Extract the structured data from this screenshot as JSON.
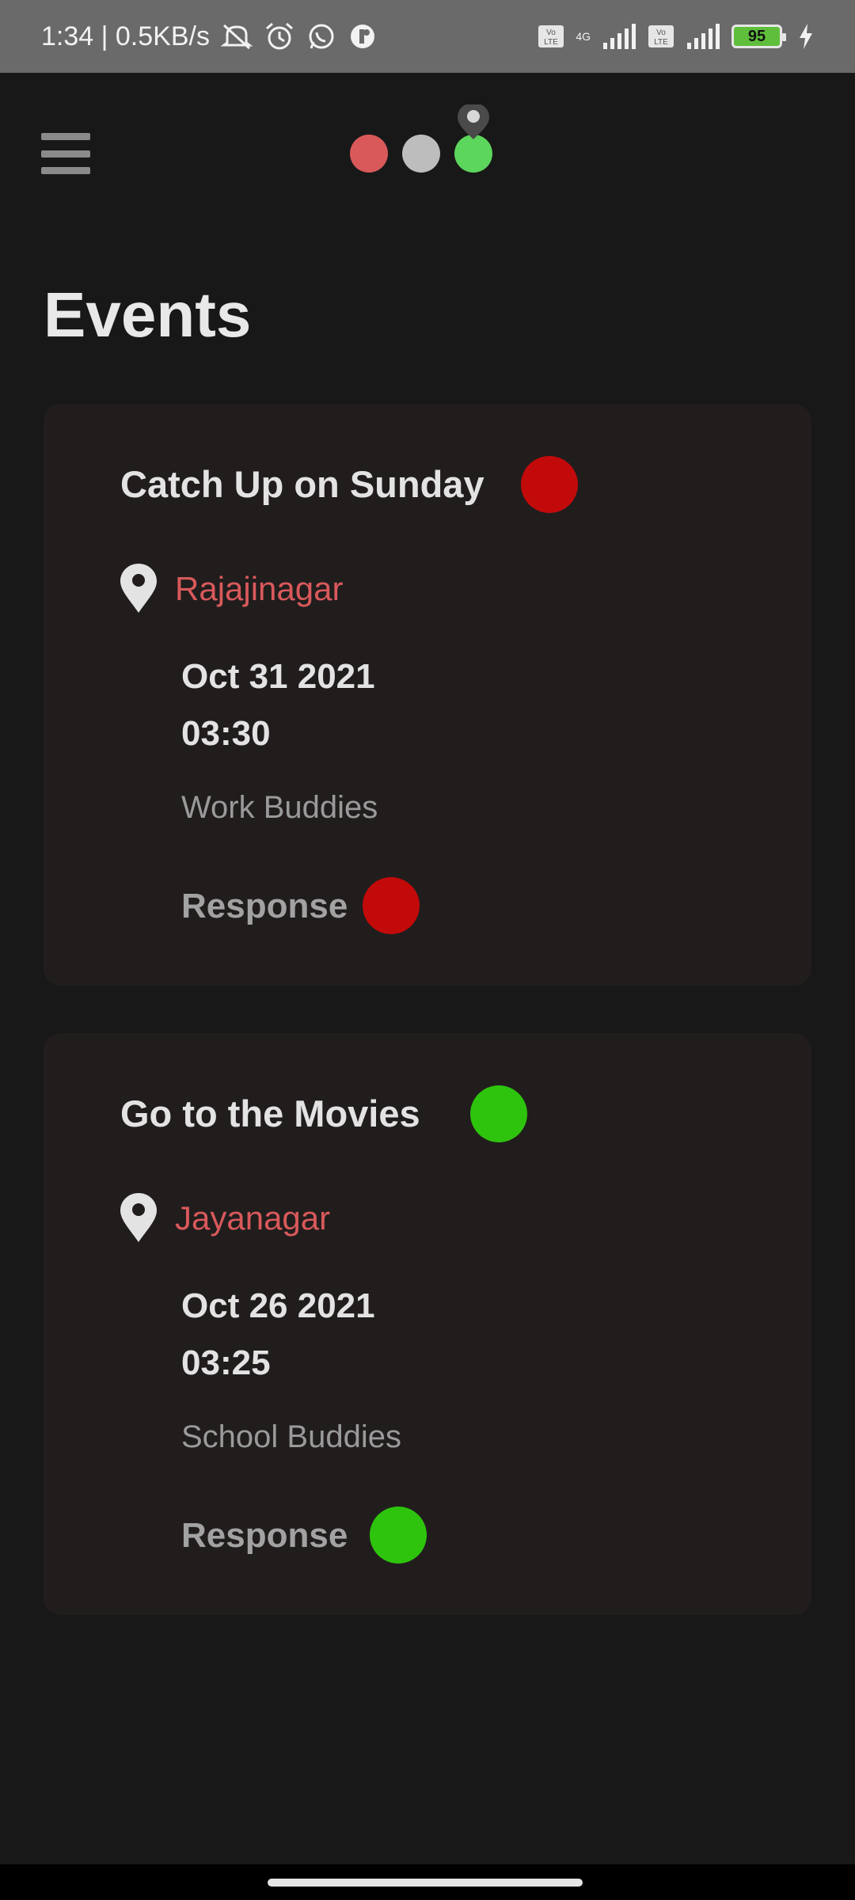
{
  "status_bar": {
    "time_speed": "1:34 | 0.5KB/s",
    "network_label": "4G",
    "volte_label": "Vo LTE",
    "battery_level": "95",
    "icons": [
      "mute-icon",
      "alarm-icon",
      "whatsapp-icon",
      "app-notification-icon",
      "volte-icon",
      "signal-icon",
      "battery-icon",
      "charging-icon"
    ]
  },
  "app_bar": {
    "menu_icon": "hamburger-menu-icon",
    "logo_colors": [
      "#d9595b",
      "#bdbdbd",
      "#5cd65c"
    ],
    "logo_pin_color": "#4a4a4a"
  },
  "page": {
    "title": "Events"
  },
  "events": [
    {
      "title": "Catch Up on Sunday",
      "status_color": "#c30a0a",
      "location": "Rajajinagar",
      "date": "Oct 31 2021",
      "time": "03:30",
      "group": "Work Buddies",
      "response_label": "Response",
      "response_color": "#c30a0a"
    },
    {
      "title": "Go to the Movies",
      "status_color": "#2ec40d",
      "location": "Jayanagar",
      "date": "Oct 26 2021",
      "time": "03:25",
      "group": "School Buddies",
      "response_label": "Response",
      "response_color": "#2ec40d"
    }
  ]
}
